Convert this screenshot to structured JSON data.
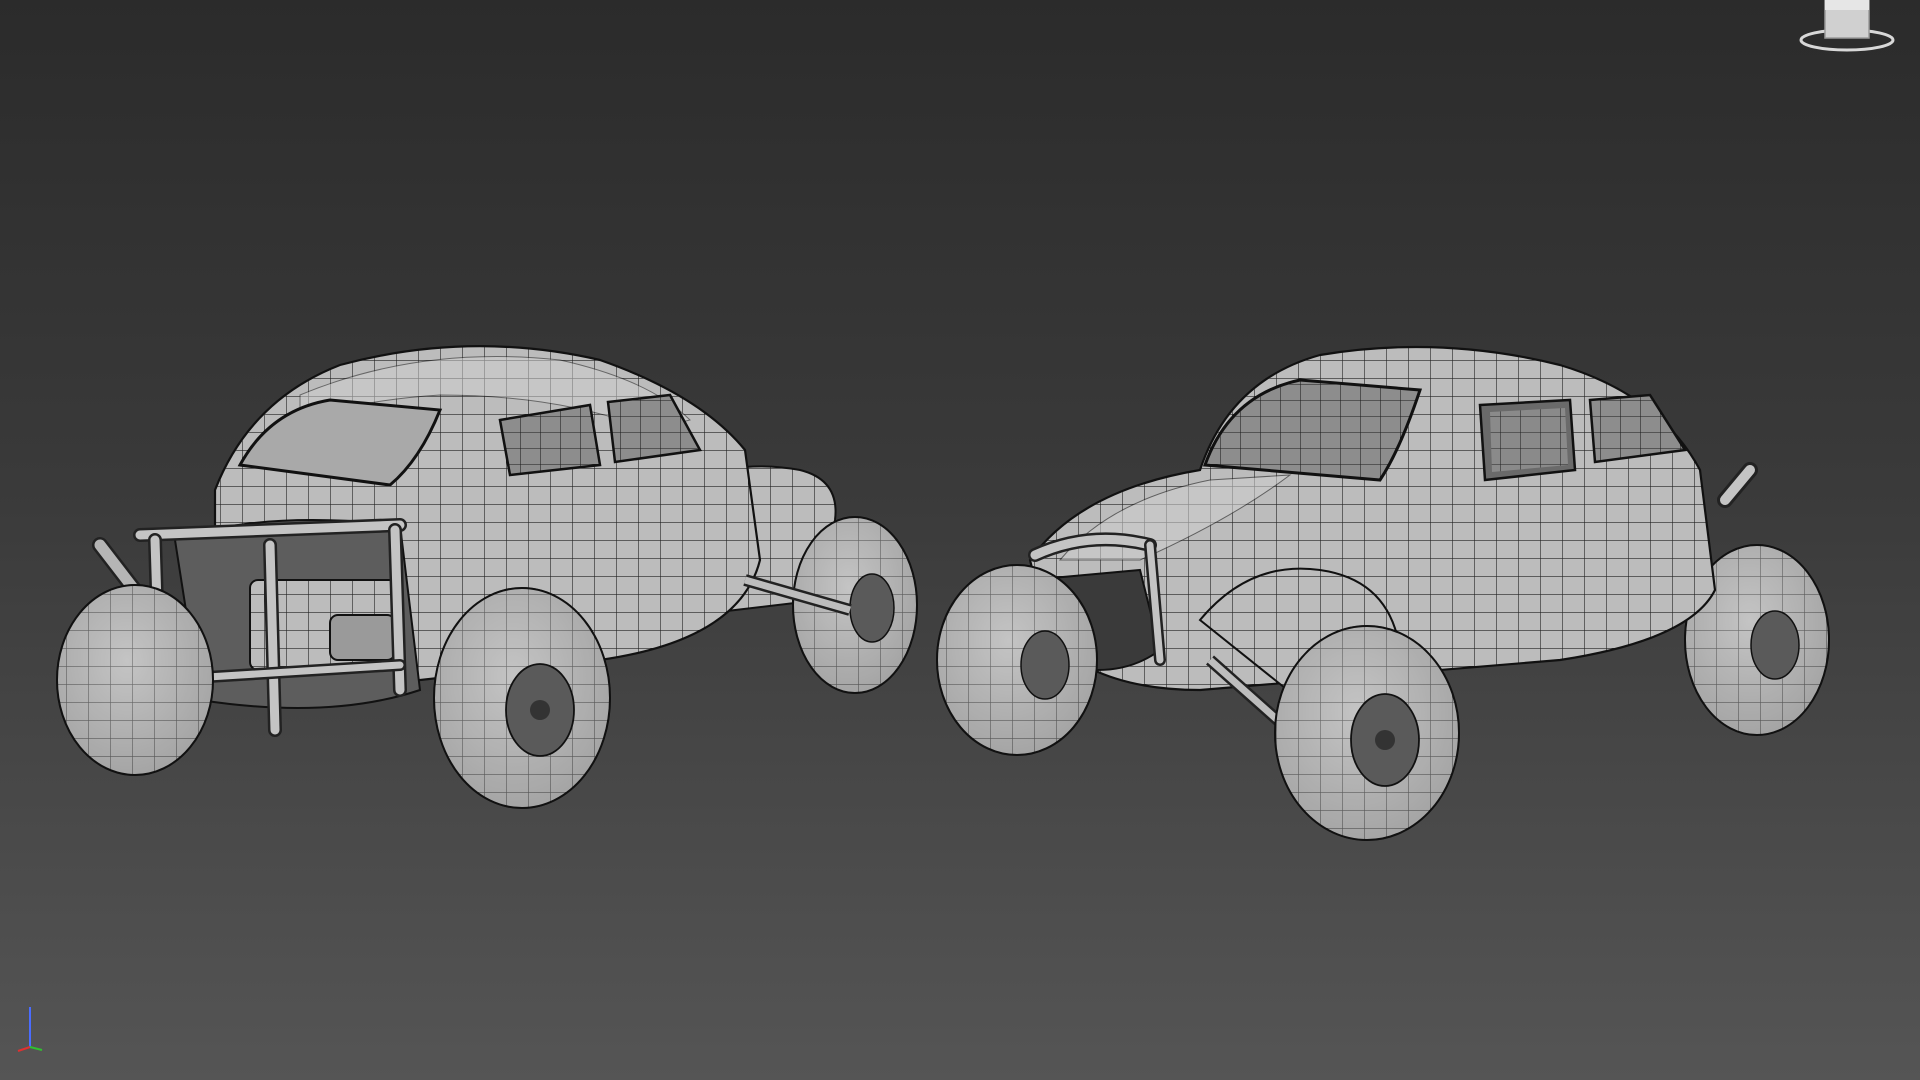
{
  "viewport": {
    "name": "perspective-viewport",
    "render_mode": "shaded-wireframe",
    "background_top": "#2b2b2b",
    "background_bottom": "#555555"
  },
  "models": [
    {
      "name": "baja-bug-rear-view",
      "view": "rear-three-quarter",
      "color": "#bdbdbd"
    },
    {
      "name": "baja-bug-front-view",
      "view": "front-three-quarter",
      "color": "#bdbdbd"
    }
  ],
  "viewcube": {
    "icon": "viewcube-icon",
    "color": "#d8d8d8"
  },
  "axis_gizmo": {
    "icon": "axis-tripod-icon",
    "axes": [
      {
        "axis": "z",
        "color": "#4a6cff"
      },
      {
        "axis": "x",
        "color": "#e03030"
      },
      {
        "axis": "y",
        "color": "#30c030"
      }
    ]
  }
}
